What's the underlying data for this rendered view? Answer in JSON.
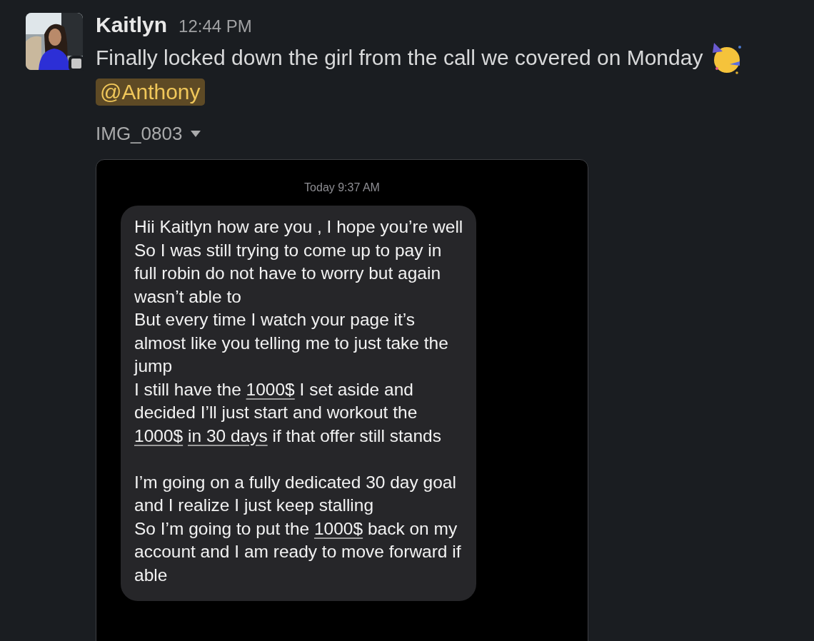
{
  "message": {
    "author": "Kaitlyn",
    "time": "12:44 PM",
    "text": "Finally locked down the girl from the call we covered on Monday",
    "mention": "@Anthony",
    "attachment": {
      "name": "IMG_0803",
      "screenshot": {
        "timestamp": "Today 9:37 AM",
        "paragraphs": [
          {
            "segments": [
              {
                "text": "Hii Kaitlyn how are you , I hope you’re well",
                "underlined": false
              }
            ]
          },
          {
            "segments": [
              {
                "text": "So I was still trying to come up to pay in full robin do not have to worry but again wasn’t able to",
                "underlined": false
              }
            ]
          },
          {
            "segments": [
              {
                "text": "But every time I watch your page it’s almost like you telling me to just take the jump",
                "underlined": false
              }
            ]
          },
          {
            "segments": [
              {
                "text": "I still have the ",
                "underlined": false
              },
              {
                "text": "1000$",
                "underlined": true
              },
              {
                "text": " I set aside and decided I’ll just start and workout the ",
                "underlined": false
              },
              {
                "text": "1000$",
                "underlined": true
              },
              {
                "text": "in 30 days",
                "underlined": true
              },
              {
                "text": " if that offer still stands",
                "underlined": false
              }
            ]
          },
          {
            "segments": [
              {
                "text": "I’m going on a fully dedicated 30 day goal and I realize I just keep stalling",
                "underlined": false
              }
            ],
            "gap_before": true
          },
          {
            "segments": [
              {
                "text": "So I’m going to put the ",
                "underlined": false
              },
              {
                "text": "1000$",
                "underlined": true
              },
              {
                "text": " back on my account and I am ready to move forward if able",
                "underlined": false
              }
            ]
          }
        ]
      }
    }
  }
}
